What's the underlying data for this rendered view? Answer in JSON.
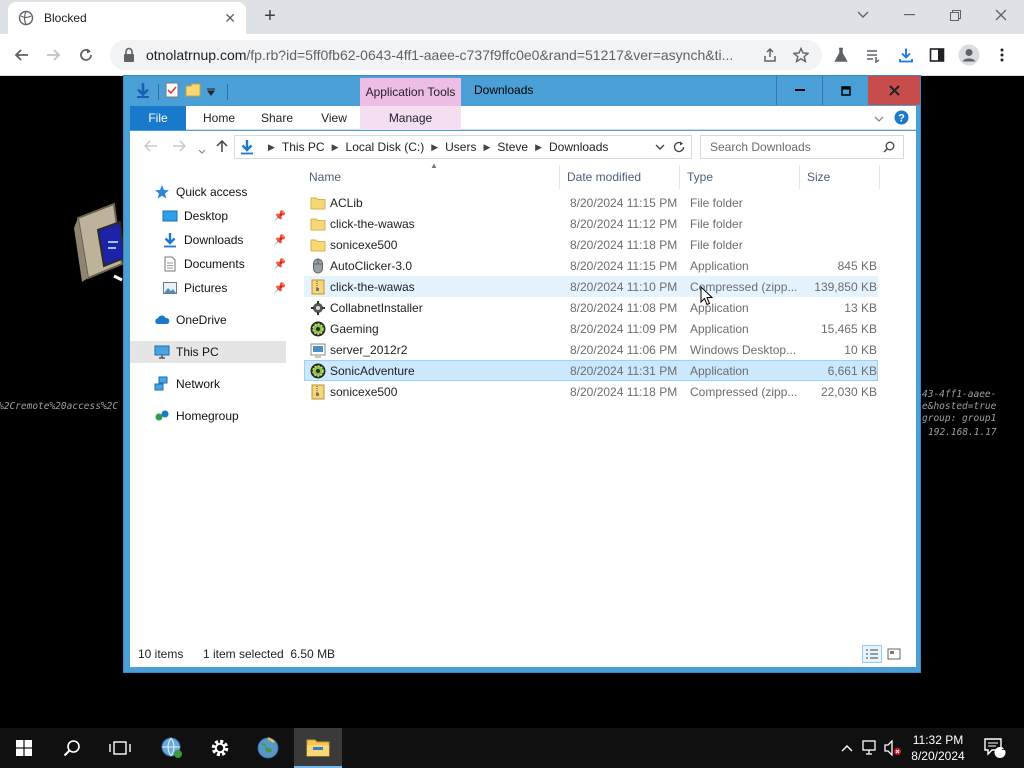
{
  "browser": {
    "tab_title": "Blocked",
    "url_host": "otnolatrnup.com",
    "url_path": "/fp.rb?id=5ff0fb62-0643-4ff1-aaee-c737f9ffc0e0&rand=51217&ver=asynch&ti...",
    "new_tab_glyph": "+",
    "tab_close_glyph": "✕"
  },
  "background": {
    "left_text": "%2Cremote%20access%2C",
    "right_text_1": "43-4ff1-aaee-",
    "right_text_2": "e&hosted=true",
    "right_text_3": "group: group1",
    "right_text_4": "192.168.1.17"
  },
  "explorer": {
    "context_tab": "Application Tools",
    "title": "Downloads",
    "ribbon_tabs": [
      "File",
      "Home",
      "Share",
      "View"
    ],
    "manage_tab": "Manage",
    "breadcrumb": [
      "This PC",
      "Local Disk (C:)",
      "Users",
      "Steve",
      "Downloads"
    ],
    "search_placeholder": "Search Downloads",
    "nav": {
      "quick_access": "Quick access",
      "desktop": "Desktop",
      "downloads": "Downloads",
      "documents": "Documents",
      "pictures": "Pictures",
      "onedrive": "OneDrive",
      "this_pc": "This PC",
      "network": "Network",
      "homegroup": "Homegroup"
    },
    "columns": {
      "name": "Name",
      "date": "Date modified",
      "type": "Type",
      "size": "Size"
    },
    "files": [
      {
        "name": "ACLib",
        "date": "8/20/2024 11:15 PM",
        "type": "File folder",
        "size": "",
        "icon": "folder-icon"
      },
      {
        "name": "click-the-wawas",
        "date": "8/20/2024 11:12 PM",
        "type": "File folder",
        "size": "",
        "icon": "folder-icon"
      },
      {
        "name": "sonicexe500",
        "date": "8/20/2024 11:18 PM",
        "type": "File folder",
        "size": "",
        "icon": "folder-icon"
      },
      {
        "name": "AutoClicker-3.0",
        "date": "8/20/2024 11:15 PM",
        "type": "Application",
        "size": "845 KB",
        "icon": "mouse-icon"
      },
      {
        "name": "click-the-wawas",
        "date": "8/20/2024 11:10 PM",
        "type": "Compressed (zipp...",
        "size": "139,850 KB",
        "icon": "zip-icon"
      },
      {
        "name": "CollabnetInstaller",
        "date": "8/20/2024 11:08 PM",
        "type": "Application",
        "size": "13 KB",
        "icon": "installer-icon"
      },
      {
        "name": "Gaeming",
        "date": "8/20/2024 11:09 PM",
        "type": "Application",
        "size": "15,465 KB",
        "icon": "gear-app-icon"
      },
      {
        "name": "server_2012r2",
        "date": "8/20/2024 11:06 PM",
        "type": "Windows Desktop...",
        "size": "10 KB",
        "icon": "rdp-icon"
      },
      {
        "name": "SonicAdventure",
        "date": "8/20/2024 11:31 PM",
        "type": "Application",
        "size": "6,661 KB",
        "icon": "gear-app-icon"
      },
      {
        "name": "sonicexe500",
        "date": "8/20/2024 11:18 PM",
        "type": "Compressed (zipp...",
        "size": "22,030 KB",
        "icon": "zip-icon"
      }
    ],
    "status_count": "10 items",
    "status_selected": "1 item selected  6.50 MB"
  },
  "taskbar": {
    "time": "11:32 PM",
    "date": "8/20/2024",
    "notification_count": "1"
  }
}
